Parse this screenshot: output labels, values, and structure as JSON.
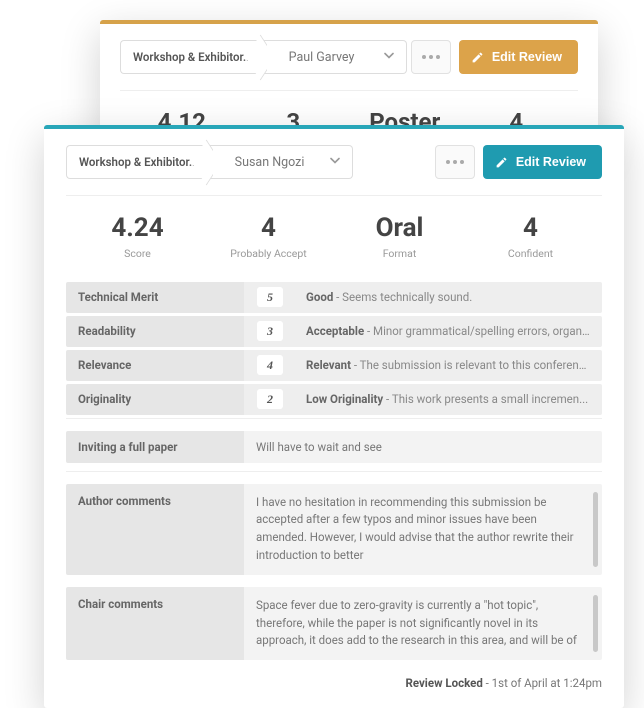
{
  "back": {
    "crumb": "Workshop & Exhibitor...",
    "reviewer": "Paul Garvey",
    "edit_label": "Edit Review",
    "stats": {
      "score": "4.12",
      "rec": "3",
      "format": "Poster",
      "conf": "4"
    }
  },
  "front": {
    "crumb": "Workshop & Exhibitor...",
    "reviewer": "Susan Ngozi",
    "edit_label": "Edit Review",
    "stats": {
      "score": {
        "val": "4.24",
        "lbl": "Score"
      },
      "rec": {
        "val": "4",
        "lbl": "Probably Accept"
      },
      "format": {
        "val": "Oral",
        "lbl": "Format"
      },
      "conf": {
        "val": "4",
        "lbl": "Confident"
      }
    },
    "rubric": [
      {
        "label": "Technical Merit",
        "score": "5",
        "strong": "Good",
        "rest": " - Seems technically sound."
      },
      {
        "label": "Readability",
        "score": "3",
        "strong": "Acceptable",
        "rest": " - Minor grammatical/spelling errors, organiz..."
      },
      {
        "label": "Relevance",
        "score": "4",
        "strong": "Relevant",
        "rest": " - The submission is relevant to this conference."
      },
      {
        "label": "Originality",
        "score": "2",
        "strong": "Low Originality",
        "rest": " - This work presents a small incremen..."
      }
    ],
    "full_paper": {
      "label": "Inviting a full paper",
      "value": "Will have to wait and see"
    },
    "author_comments": {
      "label": "Author comments",
      "value": "I have no hesitation in recommending this submission be accepted after a few typos and minor issues have been amended. However, I would advise that the author rewrite their introduction to better"
    },
    "chair_comments": {
      "label": "Chair comments",
      "value": "Space fever due to zero-gravity is currently a \"hot topic\", therefore, while the paper is not significantly novel in its approach, it does add to the research in this area, and will be of"
    },
    "footer": {
      "bold": "Review Locked",
      "rest": " - 1st of April at 1:24pm"
    }
  }
}
